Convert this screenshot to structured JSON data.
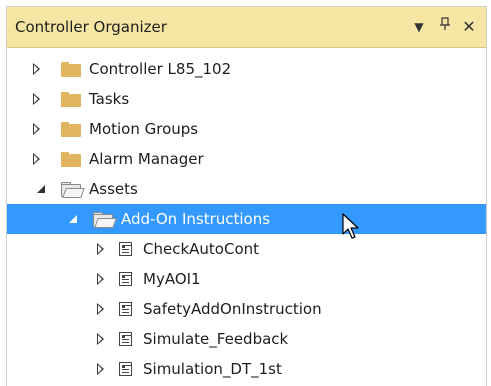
{
  "panel": {
    "title": "Controller Organizer",
    "dropdown_glyph": "▼",
    "pin_glyph": "ᚿ",
    "close_glyph": "✕"
  },
  "tree": [
    {
      "label": "Controller L85_102",
      "level": 0,
      "state": "collapsed",
      "icon": "folder-icon"
    },
    {
      "label": "Tasks",
      "level": 0,
      "state": "collapsed",
      "icon": "folder-icon"
    },
    {
      "label": "Motion Groups",
      "level": 0,
      "state": "collapsed",
      "icon": "folder-icon"
    },
    {
      "label": "Alarm Manager",
      "level": 0,
      "state": "collapsed",
      "icon": "folder-icon"
    },
    {
      "label": "Assets",
      "level": 0,
      "state": "expanded",
      "icon": "open-folder-icon"
    },
    {
      "label": "Add-On Instructions",
      "level": 1,
      "state": "expanded",
      "icon": "open-folder-icon",
      "selected": true
    },
    {
      "label": "CheckAutoCont",
      "level": 2,
      "state": "collapsed",
      "icon": "aoi-icon"
    },
    {
      "label": "MyAOI1",
      "level": 2,
      "state": "collapsed",
      "icon": "aoi-icon"
    },
    {
      "label": "SafetyAddOnInstruction",
      "level": 2,
      "state": "collapsed",
      "icon": "aoi-icon"
    },
    {
      "label": "Simulate_Feedback",
      "level": 2,
      "state": "collapsed",
      "icon": "aoi-icon"
    },
    {
      "label": "Simulation_DT_1st",
      "level": 2,
      "state": "collapsed",
      "icon": "aoi-icon"
    }
  ],
  "colors": {
    "title_bar": "#f5e6a4",
    "selection": "#3399ff",
    "folder": "#e1b460"
  }
}
